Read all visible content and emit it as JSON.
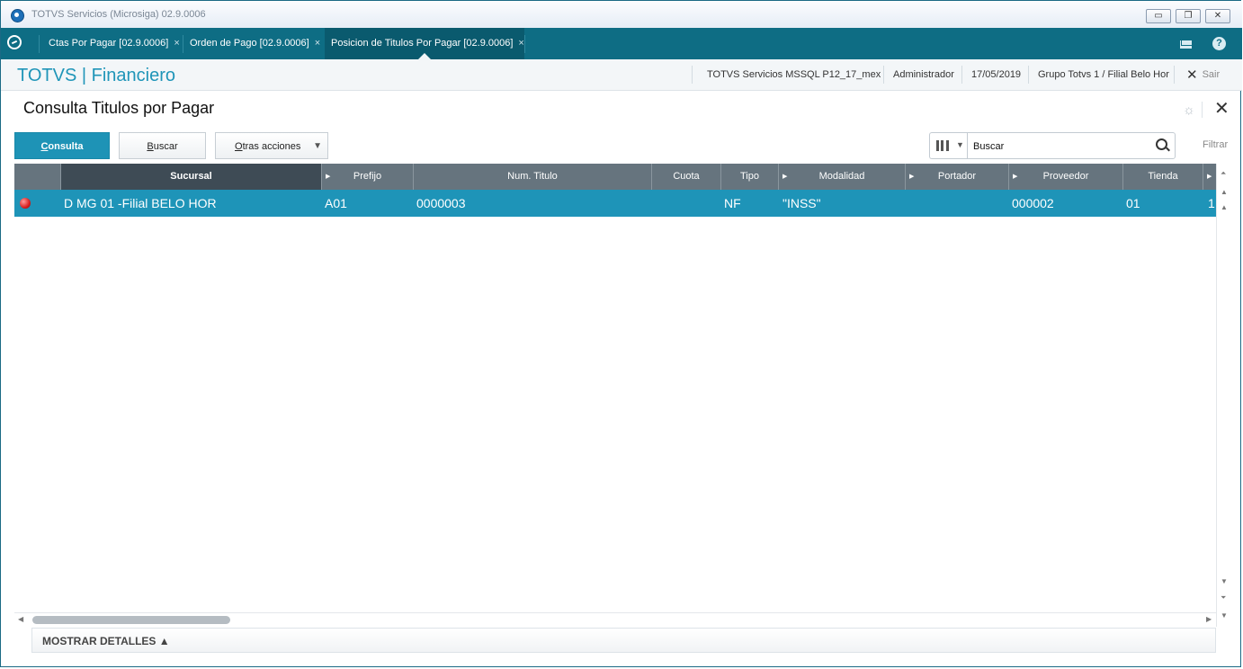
{
  "window": {
    "title": "TOTVS Servicios (Microsiga) 02.9.0006",
    "controls": [
      "minimize-icon",
      "restore-icon",
      "close-icon"
    ]
  },
  "tabs": [
    {
      "label": "Ctas Por Pagar [02.9.0006]",
      "close": "×"
    },
    {
      "label": "Orden de Pago [02.9.0006]",
      "close": "×"
    },
    {
      "label": "Posicion de Titulos Por Pagar [02.9.0006]",
      "close": "×",
      "active": true
    }
  ],
  "header": {
    "brand": "TOTVS | Financiero",
    "environment": "TOTVS Servicios MSSQL P12_17_mex",
    "user": "Administrador",
    "date": "17/05/2019",
    "branch": "Grupo Totvs 1 / Filial Belo Hor",
    "logout": "Sair"
  },
  "page": {
    "title": "Consulta Titulos por Pagar"
  },
  "toolbar": {
    "consulta": "Consulta",
    "buscar_first": "B",
    "buscar_rest": "uscar",
    "otras_first": "O",
    "otras_rest": "tras acciones",
    "consulta_first": "C",
    "consulta_rest": "onsulta"
  },
  "search": {
    "placeholder": "Buscar",
    "filter_label": "Filtrar"
  },
  "grid": {
    "columns": [
      "Sucursal",
      "Prefijo",
      "Num. Titulo",
      "Cuota",
      "Tipo",
      "Modalidad",
      "Portador",
      "Proveedor",
      "Tienda"
    ],
    "rows": [
      {
        "status": "red",
        "sucursal": "D MG 01 -Filial BELO HOR",
        "prefijo": "A01",
        "num_titulo": "0000003",
        "cuota": "",
        "tipo": "NF",
        "modalidad": "\"INSS\"",
        "portador": "",
        "proveedor": "000002",
        "tienda": "01",
        "extra": "1"
      }
    ]
  },
  "footer": {
    "details_label": "MOSTRAR DETALLES ▲"
  },
  "colors": {
    "tabbar": "#0e6d84",
    "accent": "#1e94b8",
    "grid_header": "#66747e"
  }
}
